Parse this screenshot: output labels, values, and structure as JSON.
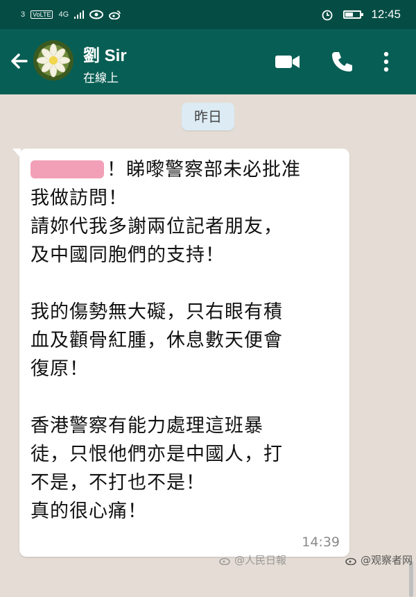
{
  "status_bar": {
    "carrier": "3",
    "volte": "VoLTE",
    "network": "4G",
    "time": "12:45",
    "battery_level": 0.55
  },
  "header": {
    "contact_name": "劉 Sir",
    "contact_status": "在線上"
  },
  "chat": {
    "date_label": "昨日",
    "message": {
      "redacted_prefix": true,
      "first_line_tail": "！睇嚟警察部未必批准",
      "body": "我做訪問！\n請妳代我多謝兩位記者朋友，\n及中國同胞們的支持！\n\n我的傷勢無大礙，只右眼有積\n血及顴骨紅腫，休息數天便會\n復原！\n\n香港警察有能力處理這班暴\n徒，只恨他們亦是中國人，打\n不是，不打也不是！\n真的很心痛！",
      "time": "14:39"
    }
  },
  "watermarks": {
    "left": "@人民日報",
    "right": "@观察者网"
  },
  "colors": {
    "status_bar": "#054d44",
    "app_bar": "#075e54",
    "chat_bg": "#e5ddd5",
    "bubble": "#ffffff",
    "date_chip": "#dcebf4"
  }
}
